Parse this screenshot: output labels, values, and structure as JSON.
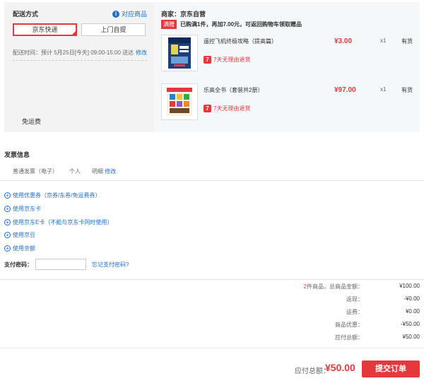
{
  "delivery": {
    "section_label": "配送方式",
    "compare_link": "对应商品",
    "options": [
      "京东快递",
      "上门自提"
    ],
    "time_label": "配送时间：",
    "time_value": "预计 5月25日[今天] 09:00-15:00 送达",
    "time_modify": "修改",
    "free_shipping": "免运费"
  },
  "seller": {
    "name": "商家：京东自营",
    "promo_tag": "满赠",
    "promo_text": "已购满1件，再加7.00元，可返回购物车领取赠品"
  },
  "items": [
    {
      "name": "遥控飞机终极攻略（提高篇）",
      "price": "¥3.00",
      "qty": "x1",
      "stock": "有货",
      "return_policy": "7天无理由退货"
    },
    {
      "name": "乐高全书（套装共2册）",
      "price": "¥97.00",
      "qty": "x1",
      "stock": "有货",
      "return_policy": "7天无理由退货"
    }
  ],
  "invoice": {
    "title": "发票信息",
    "type": "普通发票（电子）",
    "owner": "个人",
    "content": "明细",
    "modify": "修改"
  },
  "payment_options": [
    "使用优惠券（京券/东券/免运费券）",
    "使用京东卡",
    "使用京东E卡（不能与京东卡同时使用）",
    "使用京豆",
    "使用余额"
  ],
  "password": {
    "label": "支付密码：",
    "value": "",
    "forgot": "忘记支付密码?"
  },
  "summary": {
    "count": "2",
    "count_suffix": "件商品，总商品金额：",
    "goods_total": "¥100.00",
    "cashback_label": "返现：",
    "cashback": "-¥0.00",
    "freight_label": "运费：",
    "freight": "¥0.00",
    "discount_label": "商品优惠：",
    "discount": "-¥50.00",
    "payable_label": "应付总额：",
    "payable": "¥50.00"
  },
  "footer": {
    "total_label": "应付总额：",
    "total_amount": "¥50.00",
    "submit": "提交订单"
  },
  "colors": {
    "accent": "#e4393c",
    "link": "#1f6fc7",
    "panel": "#f3f3f3"
  }
}
